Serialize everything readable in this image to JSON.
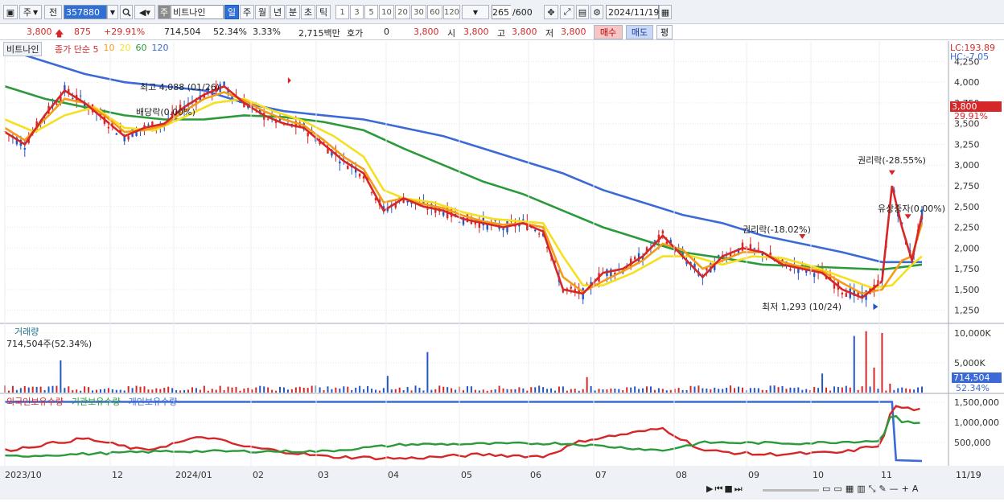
{
  "toolbar": {
    "period_type": "주",
    "prev_label": "전",
    "code": "357880",
    "name_tag": "주",
    "stock_name": "비트나인",
    "intervals": [
      "일",
      "주",
      "월",
      "년",
      "분",
      "초",
      "틱"
    ],
    "active_interval": "일",
    "minute_steps": [
      "1",
      "3",
      "5",
      "10",
      "20",
      "30",
      "60",
      "120"
    ],
    "count": "265",
    "max_count": "/600",
    "date": "2024/11/19"
  },
  "quote": {
    "price": "3,800",
    "change": "875",
    "change_pct": "+29.91%",
    "volume": "714,504",
    "volume_pct": "52.34%",
    "turnover": "3.33%",
    "amount": "2,715백만",
    "hoga_label": "호가",
    "hoga_value": "0",
    "ask": "3,800",
    "open_label": "시",
    "open": "3,800",
    "high_label": "고",
    "high": "3,800",
    "low_label": "저",
    "low": "3,800",
    "buy_label": "매수",
    "sell_label": "매도",
    "flat_label": "평"
  },
  "price_panel": {
    "title": "비트나인",
    "legend": [
      {
        "name": "종가 단순 5",
        "color": "#d62728"
      },
      {
        "name": "10",
        "color": "#f59b18"
      },
      {
        "name": "20",
        "color": "#f5e020"
      },
      {
        "name": "60",
        "color": "#2a9a3a"
      },
      {
        "name": "120",
        "color": "#3b6ad6"
      }
    ],
    "lc": "LC:193.89",
    "hc": "HC:-7.05",
    "current_price_tag": "3,800",
    "current_pct_tag": "29.91%",
    "annotations": {
      "high": "최고 4,088 (01/26)",
      "dividend": "배당락(0.00%)",
      "rights1": "권리락(-18.02%)",
      "rights2": "권리락(-28.55%)",
      "paid_in": "유상증자(0.00%)",
      "low": "최저 1,293 (10/24)"
    }
  },
  "volume_panel": {
    "title": "거래량",
    "info": "714,504주(52.34%)",
    "axis_ticks": [
      "10,000K",
      "5,000K"
    ],
    "current_tag": "714,504",
    "current_pct_tag": "52.34%"
  },
  "holdings_panel": {
    "legend": [
      {
        "name": "외국인보유수량",
        "color": "#d62728"
      },
      {
        "name": "기관보유수량",
        "color": "#2a9a3a"
      },
      {
        "name": "개인보유수량",
        "color": "#3b6ad6"
      }
    ],
    "axis_ticks": [
      "1,500,000",
      "1,000,000",
      "500,000"
    ]
  },
  "x_axis": {
    "labels": [
      "2023/10",
      "12",
      "2024/01",
      "02",
      "03",
      "04",
      "05",
      "06",
      "07",
      "08",
      "09",
      "10",
      "11"
    ],
    "right_label": "11/19"
  },
  "chart_data": {
    "type": "line",
    "title": "비트나인",
    "series_note": "daily candles 2023/10 - 2024/11/19 with MA 5/10/20/60/120",
    "x": [
      "2023/10",
      "12",
      "2024/01",
      "02",
      "03",
      "04",
      "05",
      "06",
      "07",
      "08",
      "09",
      "10",
      "11"
    ],
    "y_ticks": [
      4250,
      4000,
      3750,
      3500,
      3250,
      3000,
      2750,
      2500,
      2250,
      2000,
      1750,
      1500,
      1250
    ],
    "ylim": [
      1120,
      4380
    ],
    "series": [
      {
        "name": "5",
        "color": "#d62728",
        "points": [
          [
            0,
            3400
          ],
          [
            10,
            3250
          ],
          [
            20,
            3600
          ],
          [
            30,
            3900
          ],
          [
            40,
            3750
          ],
          [
            50,
            3550
          ],
          [
            60,
            3350
          ],
          [
            70,
            3450
          ],
          [
            80,
            3500
          ],
          [
            90,
            3700
          ],
          [
            100,
            3850
          ],
          [
            110,
            3950
          ],
          [
            120,
            3750
          ],
          [
            130,
            3600
          ],
          [
            140,
            3500
          ],
          [
            150,
            3450
          ],
          [
            160,
            3250
          ],
          [
            170,
            3050
          ],
          [
            180,
            2900
          ],
          [
            190,
            2450
          ],
          [
            200,
            2600
          ],
          [
            210,
            2500
          ],
          [
            220,
            2450
          ],
          [
            230,
            2350
          ],
          [
            240,
            2300
          ],
          [
            250,
            2250
          ],
          [
            260,
            2300
          ],
          [
            270,
            2200
          ],
          [
            280,
            1500
          ],
          [
            290,
            1450
          ],
          [
            300,
            1700
          ],
          [
            310,
            1750
          ],
          [
            320,
            1900
          ],
          [
            330,
            2150
          ],
          [
            340,
            1900
          ],
          [
            350,
            1650
          ],
          [
            360,
            1900
          ],
          [
            370,
            2000
          ],
          [
            380,
            1950
          ],
          [
            390,
            1800
          ],
          [
            400,
            1750
          ],
          [
            410,
            1700
          ],
          [
            420,
            1500
          ],
          [
            430,
            1400
          ],
          [
            440,
            1600
          ],
          [
            445,
            2750
          ],
          [
            450,
            2250
          ],
          [
            455,
            1850
          ],
          [
            460,
            2400
          ]
        ]
      },
      {
        "name": "10",
        "color": "#f59b18",
        "points": [
          [
            0,
            3450
          ],
          [
            10,
            3300
          ],
          [
            20,
            3550
          ],
          [
            30,
            3800
          ],
          [
            40,
            3750
          ],
          [
            50,
            3600
          ],
          [
            60,
            3400
          ],
          [
            70,
            3420
          ],
          [
            80,
            3480
          ],
          [
            90,
            3650
          ],
          [
            100,
            3800
          ],
          [
            110,
            3880
          ],
          [
            120,
            3780
          ],
          [
            130,
            3650
          ],
          [
            140,
            3550
          ],
          [
            150,
            3480
          ],
          [
            160,
            3300
          ],
          [
            170,
            3100
          ],
          [
            180,
            2950
          ],
          [
            190,
            2550
          ],
          [
            200,
            2600
          ],
          [
            210,
            2530
          ],
          [
            220,
            2480
          ],
          [
            230,
            2390
          ],
          [
            240,
            2320
          ],
          [
            250,
            2280
          ],
          [
            260,
            2300
          ],
          [
            270,
            2250
          ],
          [
            280,
            1650
          ],
          [
            290,
            1470
          ],
          [
            300,
            1600
          ],
          [
            310,
            1720
          ],
          [
            320,
            1850
          ],
          [
            330,
            2050
          ],
          [
            340,
            1980
          ],
          [
            350,
            1750
          ],
          [
            360,
            1850
          ],
          [
            370,
            1950
          ],
          [
            380,
            1950
          ],
          [
            390,
            1830
          ],
          [
            400,
            1770
          ],
          [
            410,
            1720
          ],
          [
            420,
            1580
          ],
          [
            430,
            1450
          ],
          [
            440,
            1500
          ],
          [
            450,
            1850
          ],
          [
            455,
            1900
          ],
          [
            460,
            2300
          ]
        ]
      },
      {
        "name": "20",
        "color": "#f5e020",
        "points": [
          [
            0,
            3550
          ],
          [
            15,
            3400
          ],
          [
            30,
            3600
          ],
          [
            45,
            3700
          ],
          [
            60,
            3450
          ],
          [
            75,
            3420
          ],
          [
            90,
            3580
          ],
          [
            105,
            3750
          ],
          [
            120,
            3800
          ],
          [
            135,
            3650
          ],
          [
            150,
            3530
          ],
          [
            165,
            3350
          ],
          [
            180,
            3100
          ],
          [
            190,
            2700
          ],
          [
            200,
            2600
          ],
          [
            215,
            2550
          ],
          [
            230,
            2430
          ],
          [
            245,
            2350
          ],
          [
            260,
            2320
          ],
          [
            270,
            2300
          ],
          [
            280,
            1900
          ],
          [
            290,
            1550
          ],
          [
            300,
            1550
          ],
          [
            315,
            1700
          ],
          [
            330,
            1900
          ],
          [
            345,
            1900
          ],
          [
            360,
            1800
          ],
          [
            375,
            1900
          ],
          [
            390,
            1880
          ],
          [
            405,
            1780
          ],
          [
            420,
            1650
          ],
          [
            435,
            1520
          ],
          [
            445,
            1550
          ],
          [
            455,
            1800
          ],
          [
            460,
            1900
          ]
        ]
      },
      {
        "name": "60",
        "color": "#2a9a3a",
        "points": [
          [
            0,
            3950
          ],
          [
            20,
            3800
          ],
          [
            40,
            3700
          ],
          [
            60,
            3600
          ],
          [
            80,
            3550
          ],
          [
            100,
            3550
          ],
          [
            120,
            3600
          ],
          [
            140,
            3580
          ],
          [
            160,
            3520
          ],
          [
            180,
            3420
          ],
          [
            200,
            3200
          ],
          [
            220,
            3000
          ],
          [
            240,
            2800
          ],
          [
            260,
            2650
          ],
          [
            280,
            2450
          ],
          [
            300,
            2250
          ],
          [
            320,
            2100
          ],
          [
            340,
            1950
          ],
          [
            360,
            1880
          ],
          [
            380,
            1800
          ],
          [
            400,
            1780
          ],
          [
            420,
            1760
          ],
          [
            440,
            1740
          ],
          [
            460,
            1800
          ]
        ]
      },
      {
        "name": "120",
        "color": "#3b6ad6",
        "points": [
          [
            0,
            4400
          ],
          [
            20,
            4250
          ],
          [
            40,
            4100
          ],
          [
            60,
            4000
          ],
          [
            80,
            3950
          ],
          [
            100,
            3900
          ],
          [
            120,
            3750
          ],
          [
            140,
            3650
          ],
          [
            160,
            3600
          ],
          [
            180,
            3550
          ],
          [
            200,
            3450
          ],
          [
            220,
            3350
          ],
          [
            240,
            3200
          ],
          [
            260,
            3050
          ],
          [
            280,
            2900
          ],
          [
            300,
            2700
          ],
          [
            320,
            2550
          ],
          [
            340,
            2400
          ],
          [
            360,
            2300
          ],
          [
            380,
            2150
          ],
          [
            400,
            2050
          ],
          [
            420,
            1950
          ],
          [
            440,
            1830
          ],
          [
            460,
            1830
          ]
        ]
      }
    ],
    "volume_panel": {
      "ylim": [
        0,
        10800
      ],
      "note": "daily volume bars, red = up, blue = down"
    },
    "holdings_series": [
      {
        "name": "외국인보유수량",
        "color": "#d62728"
      },
      {
        "name": "기관보유수량",
        "color": "#2a9a3a"
      },
      {
        "name": "개인보유수량",
        "color": "#3b6ad6"
      }
    ]
  }
}
